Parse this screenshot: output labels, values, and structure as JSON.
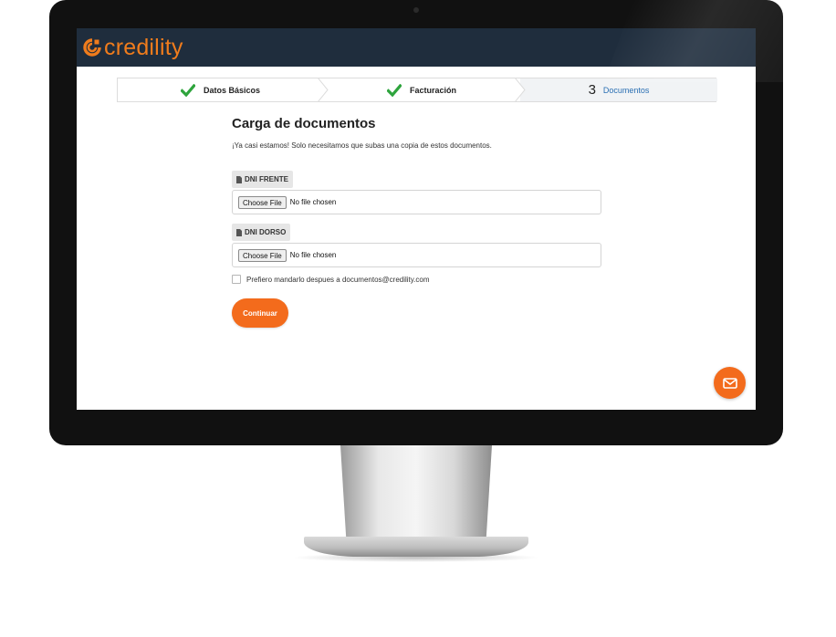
{
  "brand": {
    "name": "credility",
    "accent_color": "#f36b1c",
    "header_color": "#1f2d3d"
  },
  "stepper": {
    "steps": [
      {
        "label": "Datos Básicos",
        "state": "done",
        "icon": "check-icon"
      },
      {
        "label": "Facturación",
        "state": "done",
        "icon": "check-icon"
      },
      {
        "number": "3",
        "label": "Documentos",
        "state": "current"
      }
    ]
  },
  "form": {
    "title": "Carga de documentos",
    "subtitle": "¡Ya casi estamos! Solo necesitamos que subas una copia de estos documentos.",
    "fields": [
      {
        "label": "DNI FRENTE",
        "icon": "document-icon",
        "button": "Choose File",
        "status": "No file chosen"
      },
      {
        "label": "DNI DORSO",
        "icon": "document-icon",
        "button": "Choose File",
        "status": "No file chosen"
      }
    ],
    "checkbox_label": "Prefiero mandarlo despues a documentos@credility.com",
    "checkbox_checked": false,
    "submit_label": "Continuar"
  },
  "fab": {
    "icon": "mail-icon"
  }
}
